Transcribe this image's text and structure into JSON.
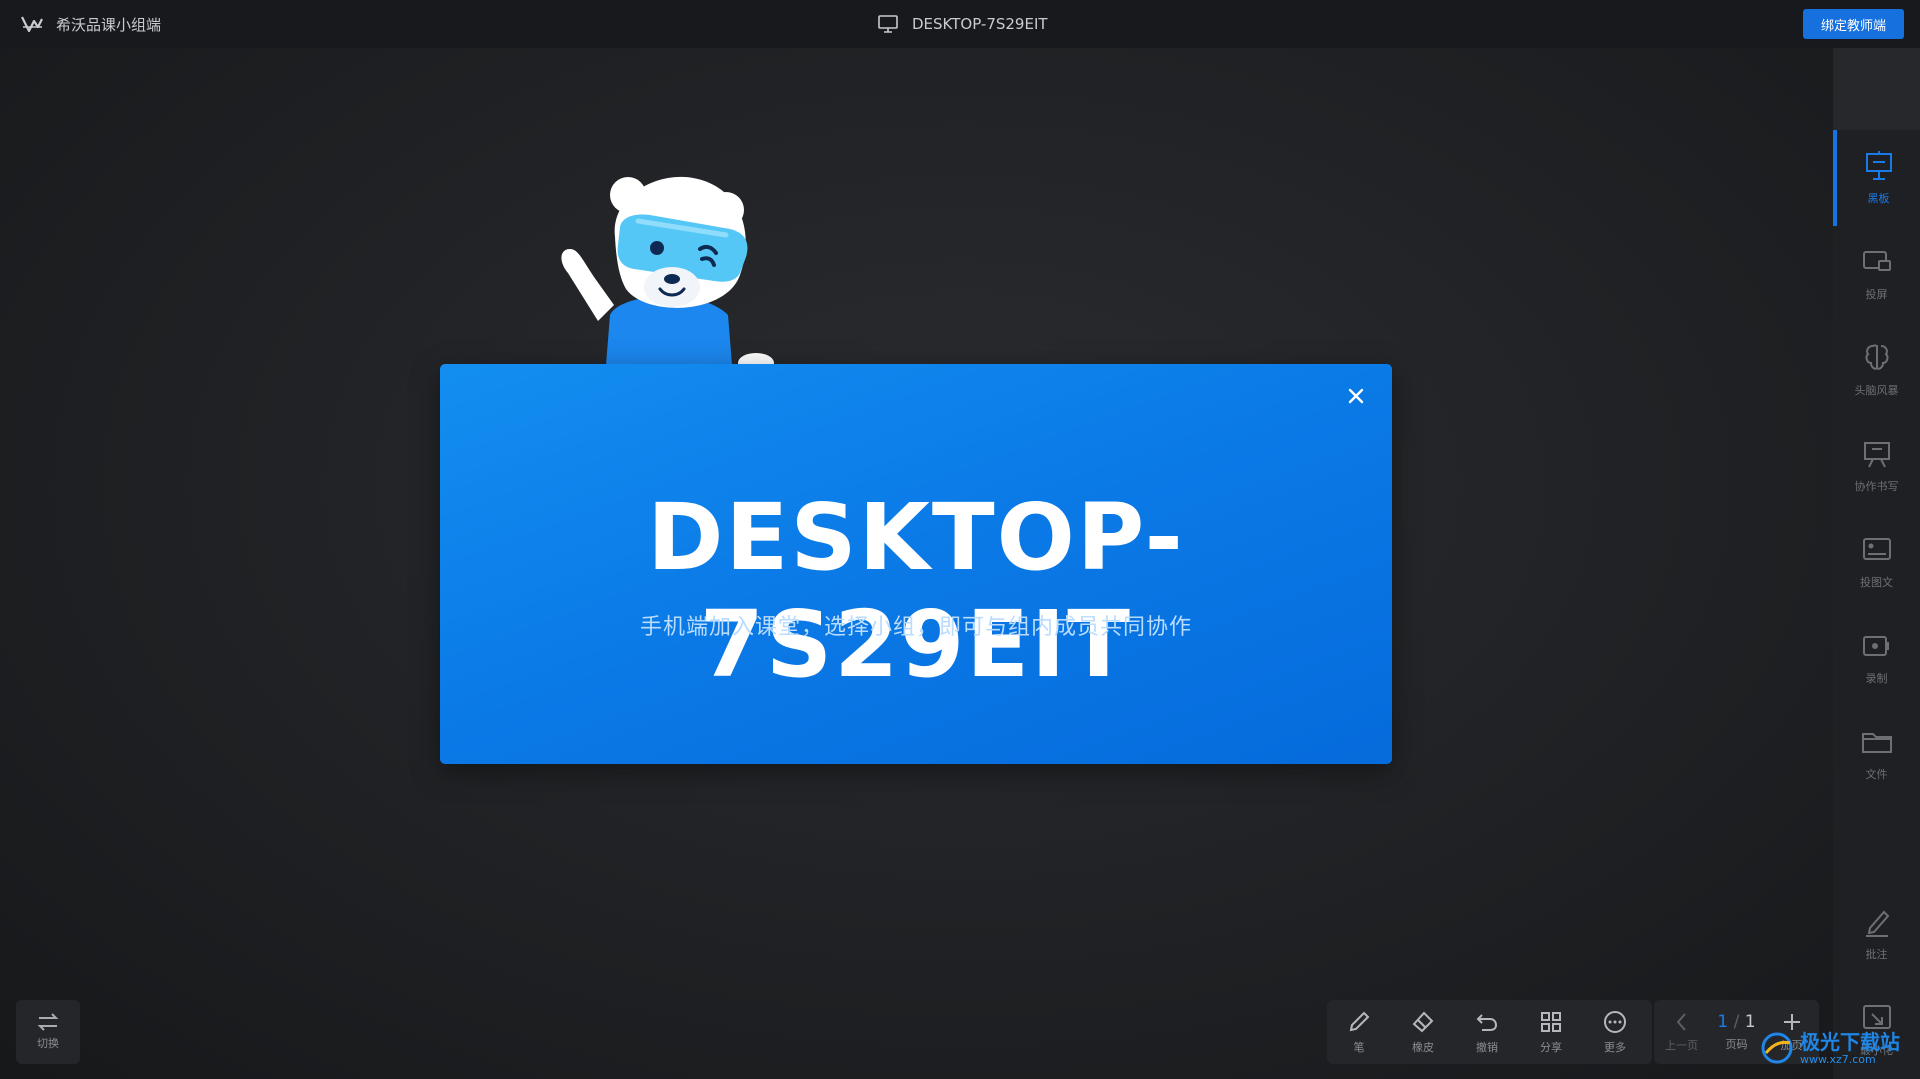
{
  "header": {
    "app_title": "希沃品课小组端",
    "device_name": "DESKTOP-7S29EIT",
    "bind_button": "绑定教师端"
  },
  "sidebar": {
    "items": [
      {
        "label": "黑板",
        "icon": "blackboard-icon",
        "active": true
      },
      {
        "label": "投屏",
        "icon": "screen-cast-icon"
      },
      {
        "label": "头脑风暴",
        "icon": "brainstorm-icon"
      },
      {
        "label": "协作书写",
        "icon": "collab-write-icon"
      },
      {
        "label": "投图文",
        "icon": "image-text-icon"
      },
      {
        "label": "录制",
        "icon": "record-icon"
      },
      {
        "label": "文件",
        "icon": "folder-icon"
      },
      {
        "label": "批注",
        "icon": "annotate-icon"
      },
      {
        "label": "最小化",
        "icon": "minimize-icon"
      }
    ]
  },
  "bottom": {
    "switch_label": "切换",
    "tools": [
      {
        "label": "笔",
        "icon": "pen-icon"
      },
      {
        "label": "橡皮",
        "icon": "eraser-icon"
      },
      {
        "label": "撤销",
        "icon": "undo-icon"
      },
      {
        "label": "分享",
        "icon": "share-icon"
      },
      {
        "label": "更多",
        "icon": "more-icon"
      }
    ],
    "prev_label": "上一页",
    "page_current": "1",
    "page_sep": " / ",
    "page_total": "1",
    "page_label": "页码",
    "add_label": "加页"
  },
  "modal": {
    "title": "DESKTOP-7S29EIT",
    "subtitle": "手机端加入课堂，选择小组，即可与组内成员共同协作"
  },
  "watermark": {
    "text": "极光下载站",
    "url": "www.xz7.com"
  },
  "colors": {
    "accent": "#1670dd",
    "modal_top": "#138ef0",
    "modal_bottom": "#066bdc",
    "background": "#1d1f22"
  }
}
